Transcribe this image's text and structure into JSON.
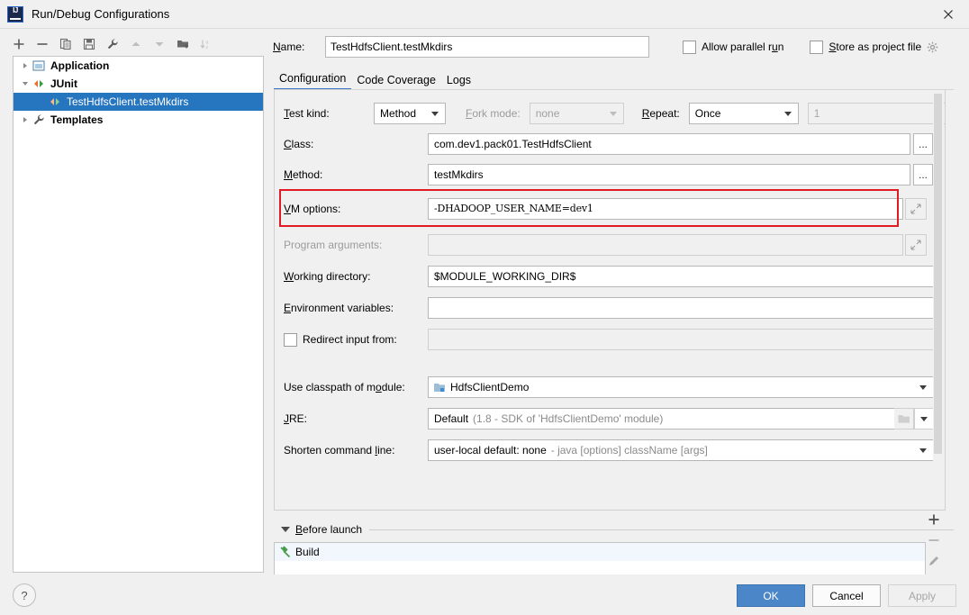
{
  "window": {
    "title": "Run/Debug Configurations",
    "app_icon": "intellij-idea-icon",
    "close_icon": "close-icon"
  },
  "left_toolbar": {
    "buttons": [
      {
        "name": "add-configuration-button",
        "icon": "plus-icon",
        "label": "+"
      },
      {
        "name": "remove-configuration-button",
        "icon": "minus-icon",
        "label": "−"
      },
      {
        "name": "copy-configuration-button",
        "icon": "copy-icon",
        "label": "Copy"
      },
      {
        "name": "save-configuration-button",
        "icon": "save-icon",
        "label": "Save"
      },
      {
        "name": "edit-templates-button",
        "icon": "wrench-icon",
        "label": "Edit Templates"
      },
      {
        "name": "move-up-button",
        "icon": "arrow-up-icon",
        "label": "Move Up"
      },
      {
        "name": "move-down-button",
        "icon": "arrow-down-icon",
        "label": "Move Down"
      },
      {
        "name": "new-folder-button",
        "icon": "folder-add-icon",
        "label": "New Folder"
      },
      {
        "name": "sort-configurations-button",
        "icon": "sort-az-icon",
        "label": "Sort"
      }
    ]
  },
  "tree": {
    "items": [
      {
        "label": "Application",
        "icon": "application-icon",
        "twisty": "collapsed",
        "level": 0,
        "selected": false
      },
      {
        "label": "JUnit",
        "icon": "junit-icon",
        "twisty": "expanded",
        "level": 0,
        "selected": false
      },
      {
        "label": "TestHdfsClient.testMkdirs",
        "icon": "junit-run-icon",
        "twisty": "none",
        "level": 1,
        "selected": true
      },
      {
        "label": "Templates",
        "icon": "wrench-icon",
        "twisty": "collapsed",
        "level": 0,
        "selected": false
      }
    ]
  },
  "header": {
    "name_label": "Name:",
    "name_value": "TestHdfsClient.testMkdirs",
    "allow_parallel_run_label": "Allow parallel run",
    "allow_parallel_run_checked": false,
    "store_as_project_file_label": "Store as project file",
    "store_as_project_file_checked": false,
    "settings_gear_icon": "gear-icon"
  },
  "tabs": [
    {
      "label": "Configuration",
      "active": true
    },
    {
      "label": "Code Coverage",
      "active": false
    },
    {
      "label": "Logs",
      "active": false
    }
  ],
  "configuration": {
    "test_kind_label": "Test kind:",
    "test_kind_value": "Method",
    "fork_mode_label": "Fork mode:",
    "fork_mode_value": "none",
    "fork_mode_disabled": true,
    "repeat_label": "Repeat:",
    "repeat_value": "Once",
    "repeat_count_value": "1",
    "repeat_count_disabled": true,
    "class_label": "Class:",
    "class_value": "com.dev1.pack01.TestHdfsClient",
    "class_browse_label": "...",
    "method_label": "Method:",
    "method_value": "testMkdirs",
    "method_browse_label": "...",
    "vm_options_label": "VM options:",
    "vm_options_value": "-DHADOOP_USER_NAME=dev1",
    "vm_options_highlighted": true,
    "vm_options_highlight_color": "#e01b24",
    "program_arguments_label": "Program arguments:",
    "program_arguments_value": "",
    "program_arguments_disabled": true,
    "working_directory_label": "Working directory:",
    "working_directory_value": "$MODULE_WORKING_DIR$",
    "environment_variables_label": "Environment variables:",
    "environment_variables_value": "",
    "redirect_input_label": "Redirect input from:",
    "redirect_input_checked": false,
    "redirect_input_value": "",
    "use_classpath_label": "Use classpath of module:",
    "use_classpath_value": "HdfsClientDemo",
    "use_classpath_icon": "module-icon",
    "jre_label": "JRE:",
    "jre_value": "Default",
    "jre_value_hint": "(1.8 - SDK of 'HdfsClientDemo' module)",
    "shorten_command_line_label": "Shorten command line:",
    "shorten_command_line_value": "user-local default: none",
    "shorten_command_line_hint": "- java [options] className [args]"
  },
  "before_launch": {
    "title": "Before launch",
    "twisty": "expanded",
    "rows": [
      {
        "label": "Build",
        "icon": "build-hammer-icon"
      }
    ],
    "add_label": "+",
    "remove_label": "−",
    "edit_icon": "pencil-icon"
  },
  "footer": {
    "help_label": "?",
    "ok_label": "OK",
    "cancel_label": "Cancel",
    "apply_label": "Apply",
    "apply_disabled": true,
    "ok_color": "#4a86c8"
  }
}
